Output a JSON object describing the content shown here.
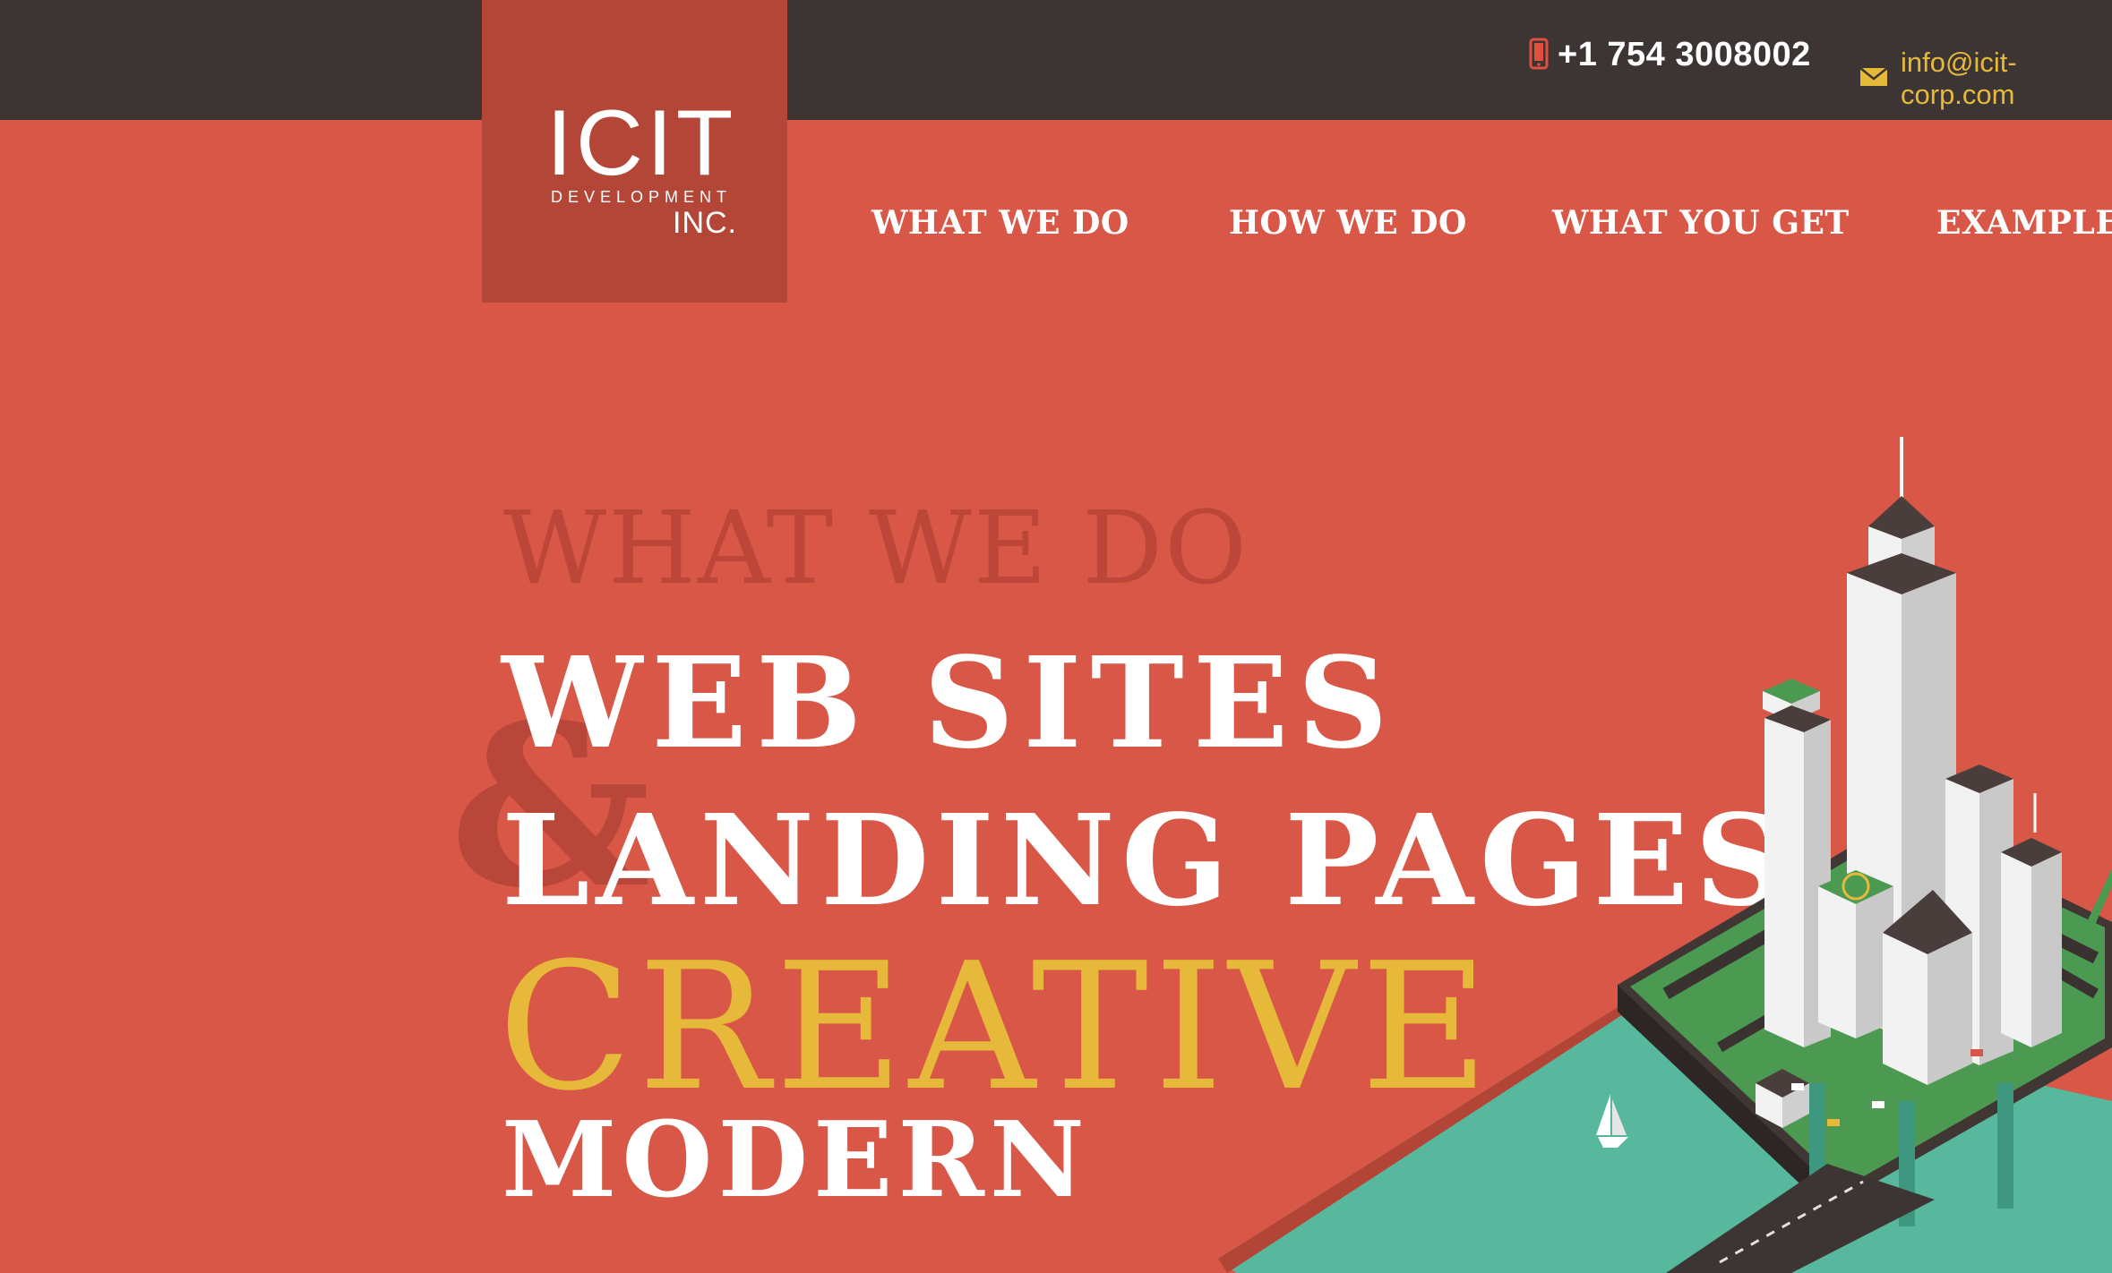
{
  "topbar": {
    "phone": "+1 754 3008002",
    "email": "info@icit-corp.com",
    "phone_icon": "mobile-phone-icon",
    "email_icon": "envelope-icon"
  },
  "logo": {
    "line1": "ICIT",
    "line2": "DEVELOPMENT",
    "line3": "INC."
  },
  "nav": {
    "items": [
      {
        "label": "WHAT WE DO"
      },
      {
        "label": "HOW WE DO"
      },
      {
        "label": "WHAT YOU GET"
      },
      {
        "label": "EXAMPLES"
      }
    ]
  },
  "hero": {
    "eyebrow": "WHAT WE DO",
    "ampersand": "&",
    "line1": "WEB SITES",
    "line2": "LANDING PAGES",
    "line3": "CREATIVE",
    "line4": "MODERN"
  },
  "colors": {
    "background": "#d95747",
    "topbar": "#3d3534",
    "logo_block": "#b34637",
    "accent_yellow": "#e6b93a",
    "water": "#57b89e"
  }
}
